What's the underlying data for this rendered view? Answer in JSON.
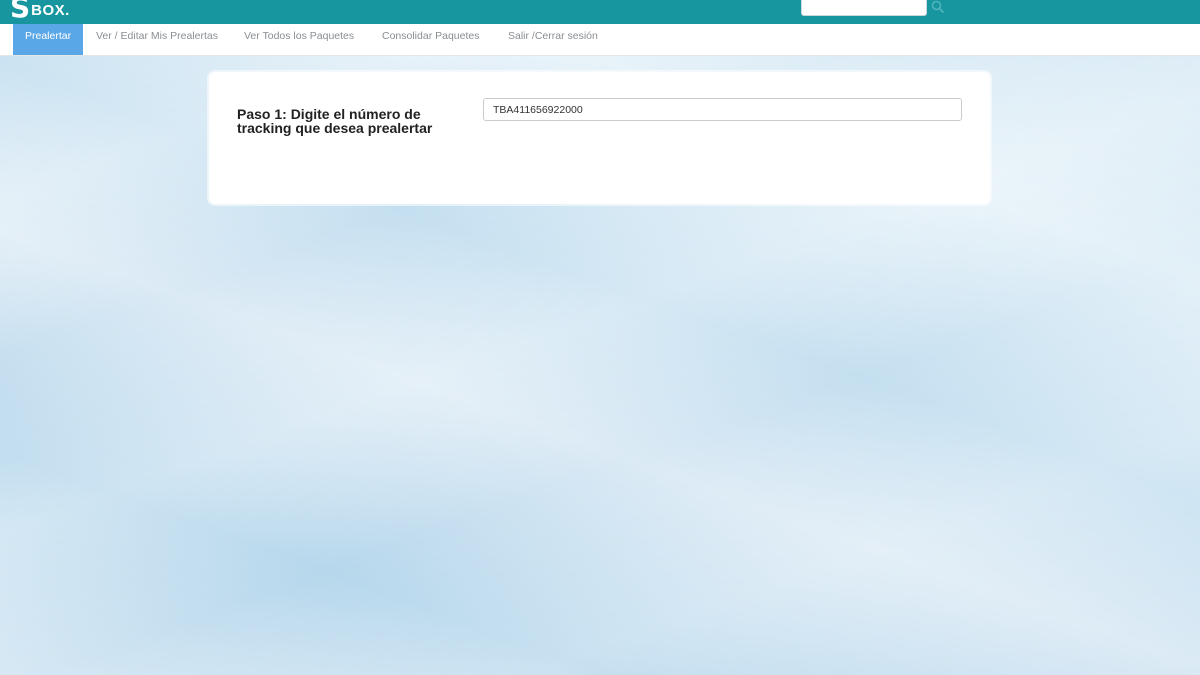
{
  "header": {
    "logo_letter": "S",
    "logo_text": "BOX.",
    "search_value": "",
    "search_icon": "search-icon",
    "colors": {
      "bar": "#1896a0",
      "active_tab": "#5aa7e8"
    }
  },
  "nav": {
    "items": [
      {
        "label": "Prealertar",
        "active": true
      },
      {
        "label": "Ver / Editar Mis Prealertas"
      },
      {
        "label": "Ver Todos los Paquetes"
      },
      {
        "label": "Consolidar Paquetes"
      },
      {
        "label": "Salir /Cerrar sesión"
      }
    ]
  },
  "form": {
    "step_label": "Paso 1: Digite el número de tracking que desea prealertar",
    "tracking_value": "TBA411656922000"
  }
}
